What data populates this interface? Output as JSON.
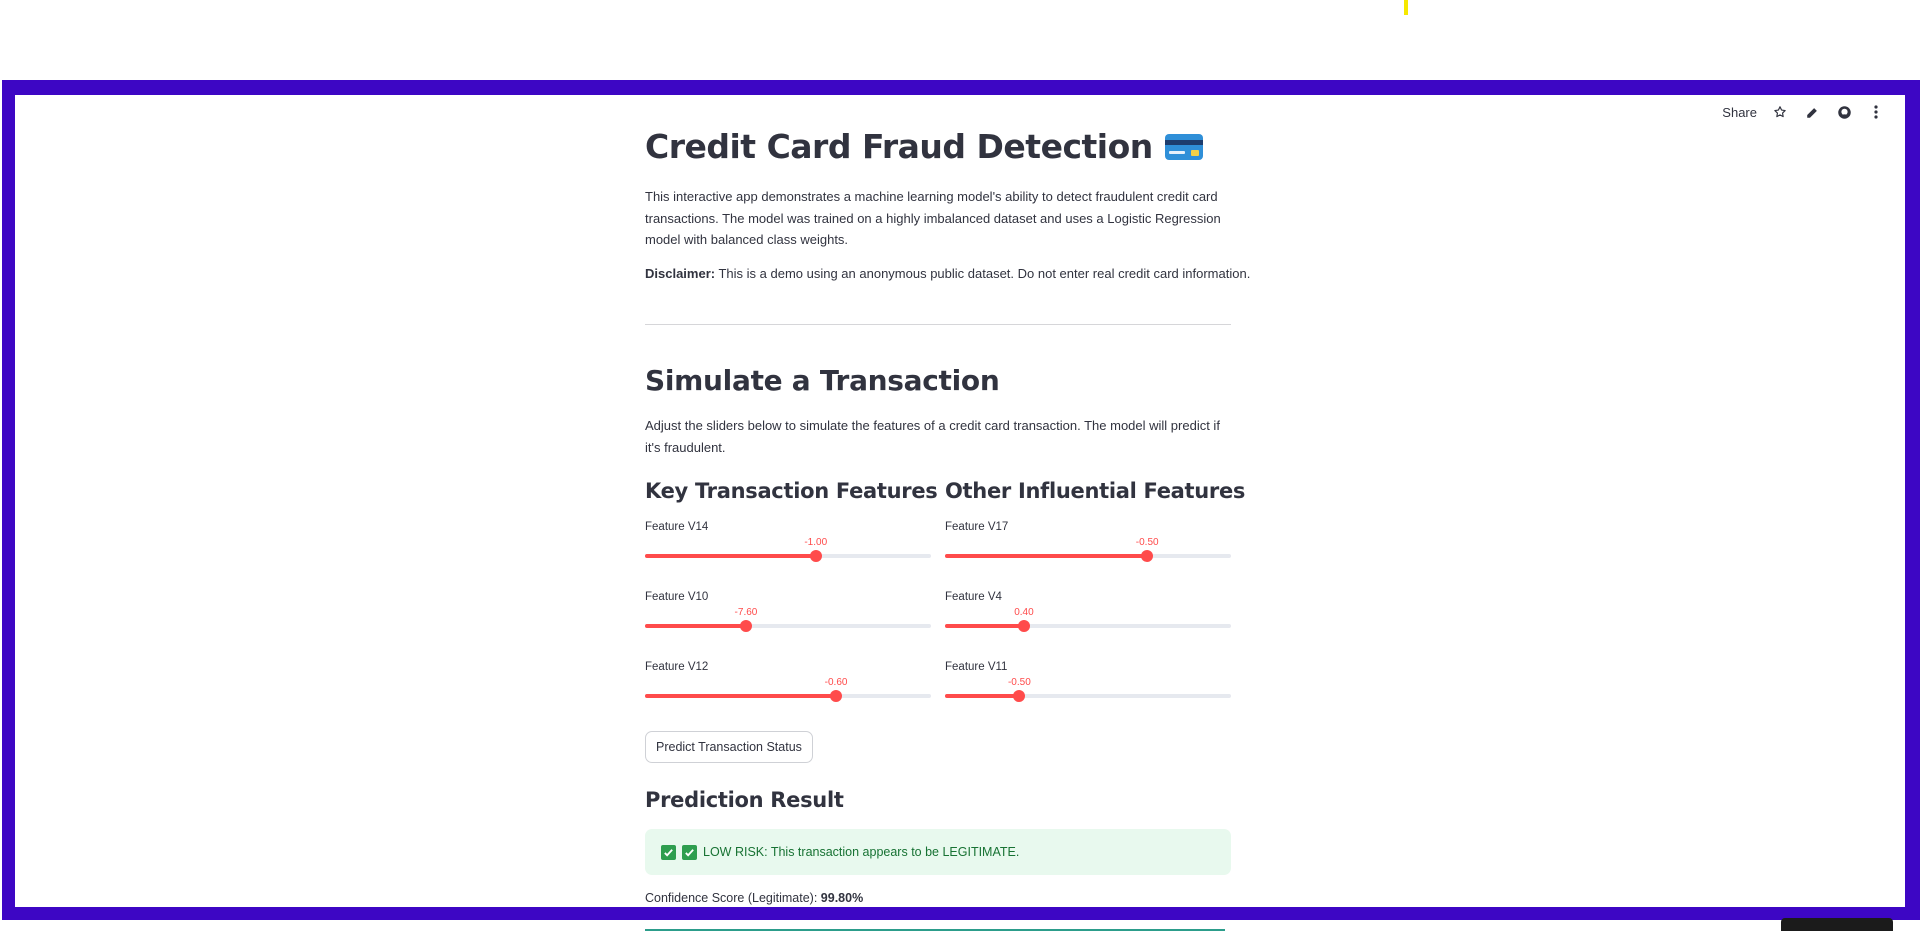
{
  "toolbar": {
    "share_label": "Share"
  },
  "title": "Credit Card Fraud Detection",
  "intro_text": "This interactive app demonstrates a machine learning model's ability to detect fraudulent credit card transactions. The model was trained on a highly imbalanced dataset and uses a Logistic Regression model with balanced class weights.",
  "disclaimer": {
    "label": "Disclaimer:",
    "text": " This is a demo using an anonymous public dataset. Do not enter real credit card information."
  },
  "simulate": {
    "heading": "Simulate a Transaction",
    "description": "Adjust the sliders below to simulate the features of a credit card transaction. The model will predict if it's fraudulent."
  },
  "key_features": {
    "heading": "Key Transaction Features",
    "sliders": [
      {
        "label": "Feature V14",
        "value_text": "-1.00",
        "fraction": 0.597
      },
      {
        "label": "Feature V10",
        "value_text": "-7.60",
        "fraction": 0.353
      },
      {
        "label": "Feature V12",
        "value_text": "-0.60",
        "fraction": 0.668
      }
    ]
  },
  "other_features": {
    "heading": "Other Influential Features",
    "sliders": [
      {
        "label": "Feature V17",
        "value_text": "-0.50",
        "fraction": 0.707
      },
      {
        "label": "Feature V4",
        "value_text": "0.40",
        "fraction": 0.276
      },
      {
        "label": "Feature V11",
        "value_text": "-0.50",
        "fraction": 0.26
      }
    ]
  },
  "predict_button_label": "Predict Transaction Status",
  "result": {
    "heading": "Prediction Result",
    "alert_text": "LOW RISK: This transaction appears to be LEGITIMATE.",
    "confidence_label": "Confidence Score (Legitimate):",
    "confidence_value": "99.80%"
  },
  "colors": {
    "frame": "#3d06c4",
    "accent": "#ff4b4b",
    "success_bg": "#e8f9ee",
    "success_text": "#177233"
  }
}
